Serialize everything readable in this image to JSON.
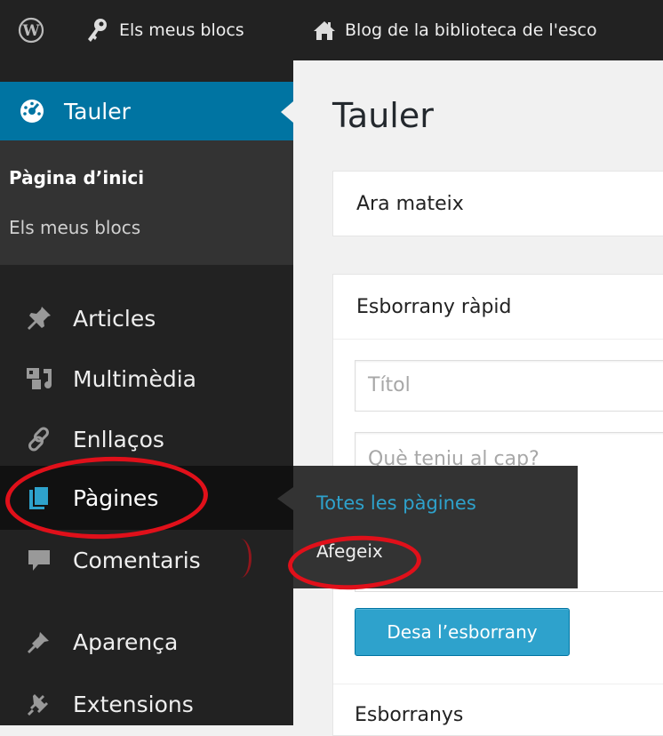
{
  "admin_bar": {
    "wp_logo_icon": "wordpress-logo-icon",
    "my_sites_icon": "wrench-key-icon",
    "my_sites_label": "Els meus blocs",
    "site_icon": "home-icon",
    "site_label": "Blog de la biblioteca de l'esco"
  },
  "sidebar": {
    "current": {
      "label": "Tauler",
      "icon": "dashboard-icon"
    },
    "current_sub": [
      {
        "label": "Pàgina d’inici"
      },
      {
        "label": "Els meus blocs"
      }
    ],
    "items": [
      {
        "label": "Articles",
        "icon": "pushpin-icon"
      },
      {
        "label": "Multimèdia",
        "icon": "media-icon"
      },
      {
        "label": "Enllaços",
        "icon": "link-icon"
      },
      {
        "label": "Pàgines",
        "icon": "pages-icon"
      },
      {
        "label": "Comentaris",
        "icon": "comment-icon"
      },
      {
        "label": "Aparença",
        "icon": "paintbrush-icon"
      },
      {
        "label": "Extensions",
        "icon": "plugin-icon"
      }
    ]
  },
  "flyout": {
    "items": [
      {
        "label": "Totes les pàgines"
      },
      {
        "label": "Afegeix"
      }
    ]
  },
  "main": {
    "title": "Tauler",
    "at_a_glance": {
      "title": "Ara mateix"
    },
    "quick_draft": {
      "title": "Esborrany ràpid",
      "title_placeholder": "Títol",
      "content_placeholder": "Què teniu al cap?",
      "save_label": "Desa l’esborrany",
      "drafts_label": "Esborranys"
    }
  },
  "colors": {
    "admin_bar": "#222222",
    "sidebar": "#222222",
    "current_menu": "#0074a2",
    "submenu": "#333333",
    "link": "#2ea2cc",
    "button": "#2ea2cc",
    "annotation": "#e0101a"
  }
}
